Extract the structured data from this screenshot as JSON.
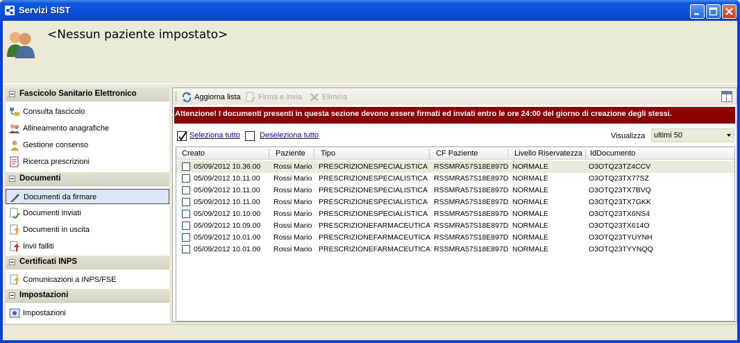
{
  "window": {
    "title": "Servizi SIST",
    "accent": "#0a4fd6",
    "icons": [
      "app-icon",
      "minimize-icon",
      "maximize-icon",
      "close-icon"
    ]
  },
  "header": {
    "patient_text": "<Nessun paziente impostato>",
    "icon": "users-icon"
  },
  "nav": {
    "groups": [
      {
        "title": "Fascicolo Sanitario Elettronico",
        "items": [
          {
            "label": "Consulta fascicolo",
            "icon": "folder-tree-icon"
          },
          {
            "label": "Allineamento anagrafiche",
            "icon": "users-sync-icon"
          },
          {
            "label": "Gestione consenso",
            "icon": "user-consent-icon"
          },
          {
            "label": "Ricerca prescrizioni",
            "icon": "prescription-search-icon"
          }
        ]
      },
      {
        "title": "Documenti",
        "items": [
          {
            "label": "Documenti da firmare",
            "icon": "pen-sign-icon",
            "selected": true
          },
          {
            "label": "Documenti inviati",
            "icon": "document-sent-icon"
          },
          {
            "label": "Documenti in uscita",
            "icon": "document-outgoing-icon"
          },
          {
            "label": "Invii falliti",
            "icon": "document-failed-icon"
          }
        ]
      },
      {
        "title": "Certificati INPS",
        "items": [
          {
            "label": "Comunicazioni a INPS/FSE",
            "icon": "document-upload-icon"
          }
        ]
      },
      {
        "title": "Impostazioni",
        "items": [
          {
            "label": "Impostazioni",
            "icon": "settings-icon"
          }
        ]
      }
    ]
  },
  "toolbar": {
    "refresh_label": "Aggiorna lista",
    "sign_label": "Firma e invia",
    "delete_label": "Elimina"
  },
  "alert": {
    "text": "Attenzione! I documenti presenti in questa sezione devono essere firmati ed inviati entro le ore 24:00 del giorno di creazione degli stessi.",
    "color": "#8b0000"
  },
  "selection": {
    "select_all": "Seleziona tutto",
    "deselect_all": "Deseleziona tutto",
    "view_label": "Visualizza",
    "view_value": "ultimi 50"
  },
  "table": {
    "columns": [
      "Creato",
      "Paziente",
      "Tipo",
      "CF Paziente",
      "Livello Riservatezza",
      "IdDocumento"
    ],
    "rows": [
      [
        "05/09/2012 10.36.00",
        "Rossi Mario",
        "PRESCRIZIONESPECIALISTICA",
        "RSSMRA57S18E897D",
        "NORMALE",
        "O3OTQ23TZ4CCV"
      ],
      [
        "05/09/2012 10.11.00",
        "Rossi Mario",
        "PRESCRIZIONESPECIALISTICA",
        "RSSMRA57S18E897D",
        "NORMALE",
        "O3OTQ23TX77SZ"
      ],
      [
        "05/09/2012 10.11.00",
        "Rossi Mario",
        "PRESCRIZIONESPECIALISTICA",
        "RSSMRA57S18E897D",
        "NORMALE",
        "O3OTQ23TX7BVQ"
      ],
      [
        "05/09/2012 10.11.00",
        "Rossi Mario",
        "PRESCRIZIONESPECIALISTICA",
        "RSSMRA57S18E897D",
        "NORMALE",
        "O3OTQ23TX7GKK"
      ],
      [
        "05/09/2012 10.10.00",
        "Rossi Mario",
        "PRESCRIZIONESPECIALISTICA",
        "RSSMRA57S18E897D",
        "NORMALE",
        "O3OTQ23TX6NS4"
      ],
      [
        "05/09/2012 10.09.00",
        "Rossi Mario",
        "PRESCRIZIONEFARMACEUTICA",
        "RSSMRA57S18E897D",
        "NORMALE",
        "O3OTQ23TX614O"
      ],
      [
        "05/09/2012 10.01.00",
        "Rossi Mario",
        "PRESCRIZIONEFARMACEUTICA",
        "RSSMRA57S18E897D",
        "NORMALE",
        "O3OTQ23TYUYNH"
      ],
      [
        "05/09/2012 10.01.00",
        "Rossi Mario",
        "PRESCRIZIONEFARMACEUTICA",
        "RSSMRA57S18E897D",
        "NORMALE",
        "O3OTQ23TYYNQQ"
      ]
    ]
  }
}
